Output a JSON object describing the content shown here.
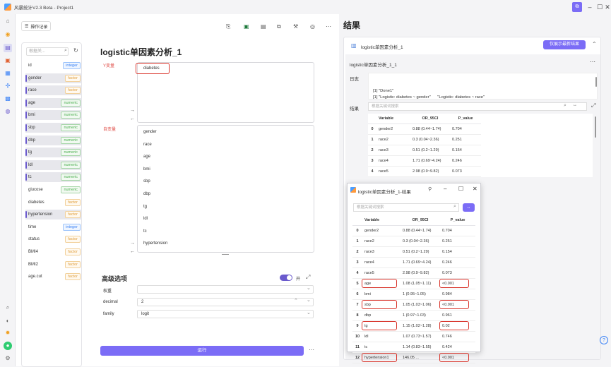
{
  "app": {
    "title": "风暴统计V2.3 Beta - Project1"
  },
  "toolbar": {
    "history_label": "操作记录"
  },
  "varpanel": {
    "search_placeholder": "根据关...",
    "vars": [
      {
        "name": "id",
        "type": "integer",
        "selected": false
      },
      {
        "name": "gender",
        "type": "factor",
        "selected": true
      },
      {
        "name": "race",
        "type": "factor",
        "selected": true
      },
      {
        "name": "age",
        "type": "numeric",
        "selected": true
      },
      {
        "name": "bmi",
        "type": "numeric",
        "selected": true
      },
      {
        "name": "sbp",
        "type": "numeric",
        "selected": true
      },
      {
        "name": "dbp",
        "type": "numeric",
        "selected": true
      },
      {
        "name": "tg",
        "type": "numeric",
        "selected": true
      },
      {
        "name": "ldl",
        "type": "numeric",
        "selected": true
      },
      {
        "name": "tc",
        "type": "numeric",
        "selected": true
      },
      {
        "name": "glucose",
        "type": "numeric",
        "selected": false
      },
      {
        "name": "diabetes",
        "type": "factor",
        "selected": false
      },
      {
        "name": "hypertension",
        "type": "factor",
        "selected": true
      },
      {
        "name": "time",
        "type": "integer",
        "selected": false
      },
      {
        "name": "status",
        "type": "factor",
        "selected": false
      },
      {
        "name": "BMI4",
        "type": "factor",
        "selected": false
      },
      {
        "name": "BMI2",
        "type": "factor",
        "selected": false
      },
      {
        "name": "age.cut",
        "type": "factor",
        "selected": false
      }
    ]
  },
  "analysis": {
    "title": "logistic单因素分析_1",
    "y_label": "Y变量",
    "y_value": "diabetes",
    "x_label": "自变量",
    "x_vars": [
      "gender",
      "race",
      "age",
      "bmi",
      "sbp",
      "dbp",
      "tg",
      "ldl",
      "tc",
      "hypertension"
    ]
  },
  "advanced": {
    "title": "高级选项",
    "toggle_label": "开",
    "weight_label": "权重",
    "weight_value": "",
    "decimal_label": "decimal",
    "decimal_value": "2",
    "family_label": "family",
    "family_value": "logit"
  },
  "run": {
    "label": "运行"
  },
  "results": {
    "title": "结果",
    "card_title": "logistic单因素分析_1",
    "latest_btn": "仅展示最新结果",
    "sub_title": "logistic单因素分析_1_1",
    "log_label": "日志",
    "log_lines": [
      "[1] \"Done1\"",
      "[1] \"Logistic: diabetes ~ gender\"      \"Logistic: diabetes ~ race\"",
      "[3] \"Logistic: diabetes ~ age\"         \"Logistic: diabetes ~ bmi\"",
      "[5] \"Logistic: diabetes ~ sbp\"         \"Logistic: diabetes ~ dbp\""
    ],
    "result_label": "结果",
    "search_placeholder": "根据关键词搜索",
    "cols": [
      "Variable",
      "OR_95CI",
      "P_value"
    ],
    "rows": [
      [
        "0",
        "gender2",
        "0.88 (0.44~1.74)",
        "0.704"
      ],
      [
        "1",
        "race2",
        "0.3 (0.04~2.36)",
        "0.251"
      ],
      [
        "2",
        "race3",
        "0.51 (0.2~1.29)",
        "0.154"
      ],
      [
        "3",
        "race4",
        "1.71 (0.69~4.24)",
        "0.246"
      ],
      [
        "4",
        "race5",
        "2.98 (0.9~9.82)",
        "0.073"
      ]
    ]
  },
  "popup": {
    "title": "logistic单因素分析_1-结果",
    "search_placeholder": "根据关键词搜索",
    "cols": [
      "Variable",
      "OR_95CI",
      "P_value"
    ],
    "rows": [
      [
        "0",
        "gender2",
        "0.88 (0.44~1.74)",
        "0.704"
      ],
      [
        "1",
        "race2",
        "0.3 (0.04~2.36)",
        "0.251"
      ],
      [
        "2",
        "race3",
        "0.51 (0.2~1.29)",
        "0.154"
      ],
      [
        "3",
        "race4",
        "1.71 (0.69~4.24)",
        "0.246"
      ],
      [
        "4",
        "race5",
        "2.98 (0.9~9.82)",
        "0.073"
      ],
      [
        "5",
        "age",
        "1.08 (1.05~1.11)",
        "<0.001"
      ],
      [
        "6",
        "bmi",
        "1 (0.95~1.05)",
        "0.984"
      ],
      [
        "7",
        "sbp",
        "1.05 (1.03~1.06)",
        "<0.001"
      ],
      [
        "8",
        "dbp",
        "1 (0.97~1.03)",
        "0.961"
      ],
      [
        "9",
        "tg",
        "1.15 (1.02~1.28)",
        "0.02"
      ],
      [
        "10",
        "ldl",
        "1.07 (0.73~1.57)",
        "0.746"
      ],
      [
        "11",
        "tc",
        "1.14 (0.83~1.55)",
        "0.424"
      ],
      [
        "12",
        "hypertension1",
        "146.05 ...",
        "<0.001"
      ]
    ],
    "highlight_rows": [
      5,
      7,
      9,
      12
    ]
  },
  "colors": {
    "accent": "#7b6cf6",
    "highlight": "#d9342b"
  }
}
